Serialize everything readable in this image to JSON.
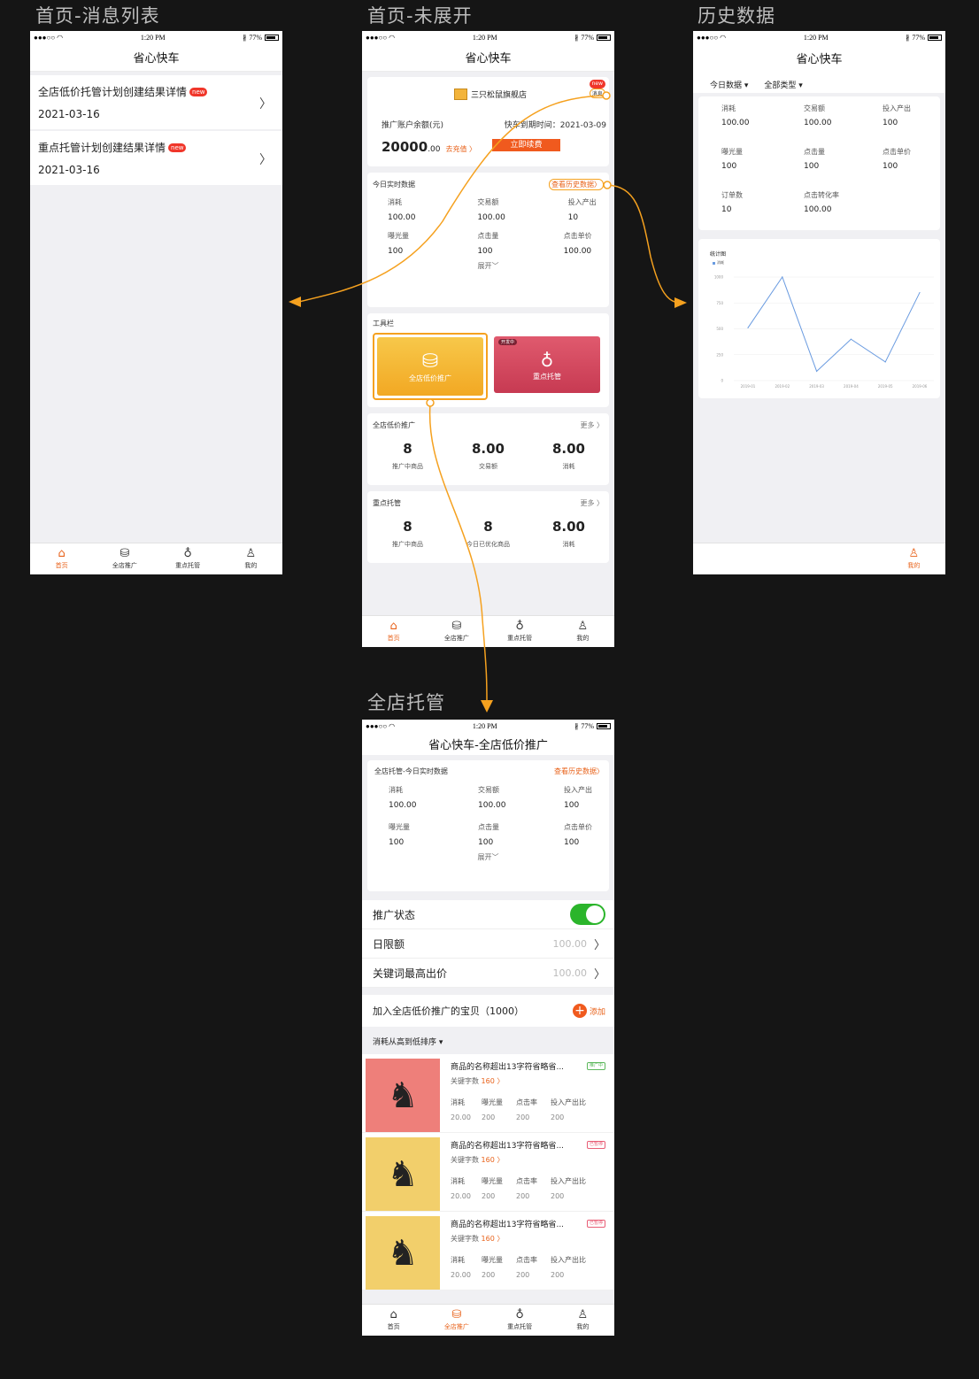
{
  "boards": {
    "b1": "首页-消息列表",
    "b2": "首页-未展开",
    "b3": "历史数据",
    "b4": "全店托管"
  },
  "status": {
    "carrier": "●●●○○",
    "time": "1:20 PM",
    "battery": "77%"
  },
  "tabs": {
    "home": "首页",
    "promo": "全店推广",
    "key": "重点托管",
    "mine": "我的"
  },
  "screen1": {
    "title": "省心快车",
    "messages": [
      {
        "title": "全店低价托管计划创建结果详情",
        "badge": "new",
        "date": "2021-03-16"
      },
      {
        "title": "重点托管计划创建结果详情",
        "badge": "new",
        "date": "2021-03-16"
      }
    ]
  },
  "screen2": {
    "title": "省心快车",
    "shop_name": "三只松鼠旗舰店",
    "msg_badge": "new",
    "msg_label": "消息",
    "balance_label": "推广账户余额(元)",
    "expiry": "快车到期时间：2021-03-09",
    "balance_int": "20000",
    "balance_dec": ".00",
    "recharge": "去充值 〉",
    "renew": "立即续费",
    "today_title": "今日实时数据",
    "history_link": "查看历史数据〉",
    "stats": [
      {
        "label": "消耗",
        "value": "100.00"
      },
      {
        "label": "交易额",
        "value": "100.00"
      },
      {
        "label": "投入产出",
        "value": "10"
      },
      {
        "label": "曝光量",
        "value": "100"
      },
      {
        "label": "点击量",
        "value": "100"
      },
      {
        "label": "点击单价",
        "value": "100.00"
      }
    ],
    "expand": "展开﹀",
    "toolbar_title": "工具栏",
    "tool1": "全店低价推广",
    "tool2": "重点托管",
    "tool2_badge": "开发中",
    "sec1": {
      "title": "全店低价推广",
      "more": "更多 〉",
      "items": [
        {
          "num": "8",
          "label": "推广中商品"
        },
        {
          "num": "8.00",
          "label": "交易额"
        },
        {
          "num": "8.00",
          "label": "消耗"
        }
      ]
    },
    "sec2": {
      "title": "重点托管",
      "more": "更多 〉",
      "items": [
        {
          "num": "8",
          "label": "推广中商品"
        },
        {
          "num": "8",
          "label": "今日已优化商品"
        },
        {
          "num": "8.00",
          "label": "消耗"
        }
      ]
    }
  },
  "screen3": {
    "title": "省心快车",
    "filter1": "今日数据 ▾",
    "filter2": "全部类型 ▾",
    "stats": [
      {
        "label": "消耗",
        "value": "100.00"
      },
      {
        "label": "交易额",
        "value": "100.00"
      },
      {
        "label": "投入产出",
        "value": "100"
      },
      {
        "label": "曝光量",
        "value": "100"
      },
      {
        "label": "点击量",
        "value": "100"
      },
      {
        "label": "点击单价",
        "value": "100"
      },
      {
        "label": "订单数",
        "value": "10"
      },
      {
        "label": "点击转化率",
        "value": "100.00"
      }
    ],
    "chart_title": "统计图"
  },
  "chart_data": {
    "type": "line",
    "title": "统计图",
    "series": [
      {
        "name": "消耗",
        "values": [
          510,
          1000,
          90,
          400,
          180,
          850
        ]
      }
    ],
    "categories": [
      "2019-01",
      "2019-02",
      "2019-03",
      "2019-04",
      "2019-05",
      "2019-06"
    ],
    "yticks": [
      "0",
      "250",
      "500",
      "750",
      "1000"
    ],
    "ylim": [
      0,
      1000
    ],
    "color": "#6a9be0",
    "legend": "top-left",
    "grid": true
  },
  "screen4": {
    "title": "省心快车-全店低价推广",
    "section_title": "全店托管-今日实时数据",
    "history_link": "查看历史数据〉",
    "stats": [
      {
        "label": "消耗",
        "value": "100.00"
      },
      {
        "label": "交易额",
        "value": "100.00"
      },
      {
        "label": "投入产出",
        "value": "100"
      },
      {
        "label": "曝光量",
        "value": "100"
      },
      {
        "label": "点击量",
        "value": "100"
      },
      {
        "label": "点击单价",
        "value": "100"
      }
    ],
    "expand": "展开﹀",
    "promo_status": "推广状态",
    "daily_limit": "日限额",
    "daily_limit_val": "100.00",
    "kw_bid": "关键词最高出价",
    "kw_bid_val": "100.00",
    "items_title": "加入全店低价推广的宝贝（1000）",
    "add": "添加",
    "sort": "消耗从高到低排序 ▾",
    "metric_labels": [
      "消耗",
      "曝光量",
      "点击率",
      "投入产出比"
    ],
    "products": [
      {
        "name": "商品的名称超出13字符省略省...",
        "tag": "推广中",
        "tag_color": "#5cb85c",
        "kw_label": "关键字数",
        "kw_count": "160 〉",
        "vals": [
          "20.00",
          "200",
          "200",
          "200"
        ],
        "bg": "#ee7f7a"
      },
      {
        "name": "商品的名称超出13字符省略省...",
        "tag": "已暂停",
        "tag_color": "#e85d75",
        "kw_label": "关键字数",
        "kw_count": "160 〉",
        "vals": [
          "20.00",
          "200",
          "200",
          "200"
        ],
        "bg": "#f2cf6b"
      },
      {
        "name": "商品的名称超出13字符省略省...",
        "tag": "已暂停",
        "tag_color": "#e85d75",
        "kw_label": "关键字数",
        "kw_count": "160 〉",
        "vals": [
          "20.00",
          "200",
          "200",
          "200"
        ],
        "bg": "#f2cf6b"
      }
    ]
  }
}
